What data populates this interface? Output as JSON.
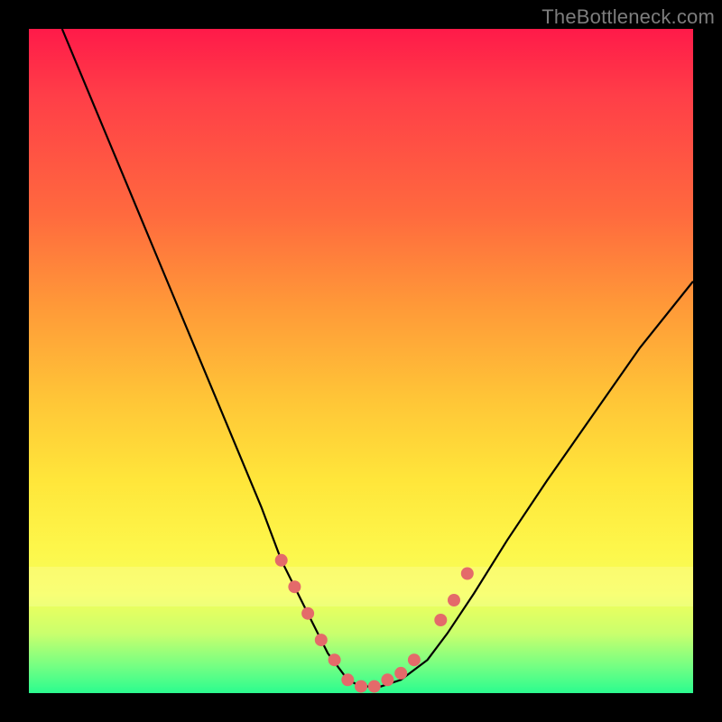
{
  "watermark": "TheBottleneck.com",
  "colors": {
    "frame": "#000000",
    "curve": "#000000",
    "dots": "#e46a6a",
    "gradient_top": "#ff1a49",
    "gradient_bottom": "#2bfc8f"
  },
  "chart_data": {
    "type": "line",
    "title": "",
    "xlabel": "",
    "ylabel": "",
    "xlim": [
      0,
      100
    ],
    "ylim": [
      0,
      100
    ],
    "grid": false,
    "legend": false,
    "series": [
      {
        "name": "bottleneck-curve",
        "x": [
          5,
          10,
          15,
          20,
          25,
          30,
          35,
          38,
          42,
          45,
          48,
          50,
          53,
          56,
          60,
          63,
          67,
          72,
          78,
          85,
          92,
          100
        ],
        "y": [
          100,
          88,
          76,
          64,
          52,
          40,
          28,
          20,
          12,
          6,
          2,
          1,
          1,
          2,
          5,
          9,
          15,
          23,
          32,
          42,
          52,
          62
        ]
      }
    ],
    "highlight_points": {
      "name": "near-minimum-dots",
      "x": [
        38,
        40,
        42,
        44,
        46,
        48,
        50,
        52,
        54,
        56,
        58,
        62,
        64,
        66
      ],
      "y": [
        20,
        16,
        12,
        8,
        5,
        2,
        1,
        1,
        2,
        3,
        5,
        11,
        14,
        18
      ]
    }
  }
}
